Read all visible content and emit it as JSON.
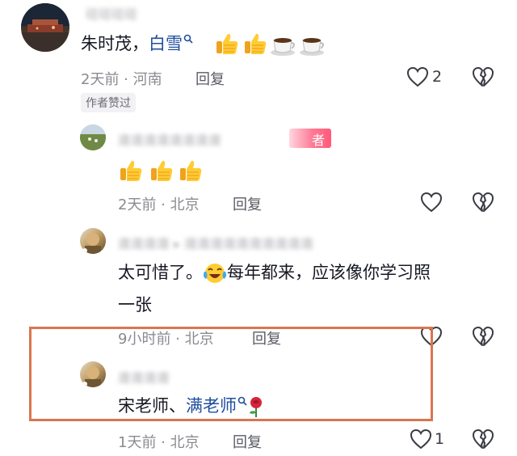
{
  "comments": [
    {
      "author_name": "碰碰碰碰",
      "text_lead": "朱时茂，",
      "text_link": "白雪",
      "meta": "2天前 · 河南",
      "reply_label": "回复",
      "like_count": "2",
      "author_badge": "作者赞过"
    },
    {
      "author_name": "庸庸庸庸庸庸庸庸",
      "name_tag": "者",
      "meta": "2天前 · 北京",
      "reply_label": "回复"
    },
    {
      "author_name": "庸庸庸庸 ▸ 庸庸庸庸庸庸庸庸庸庸",
      "text_line1a": "太可惜了。",
      "text_line1b": "每年都来，应该像你学习照",
      "text_line2": "一张",
      "meta": "9小时前 · 北京",
      "reply_label": "回复"
    },
    {
      "author_name": "庸庸庸庸",
      "text_lead": "宋老师、",
      "text_link": "满老师",
      "meta": "1天前 · 北京",
      "reply_label": "回复",
      "like_count": "1"
    }
  ],
  "icons": {
    "like": "heart-outline-icon",
    "dislike": "broken-heart-icon",
    "search": "search-icon",
    "thumbs_up": "thumbs-up-emoji",
    "coffee": "coffee-emoji",
    "crying_laugh": "crying-laughing-emoji",
    "rose": "rose-emoji"
  },
  "colors": {
    "link": "#1f4e9e",
    "highlight_border": "#d9764f",
    "tag": "#ff5a7a"
  }
}
